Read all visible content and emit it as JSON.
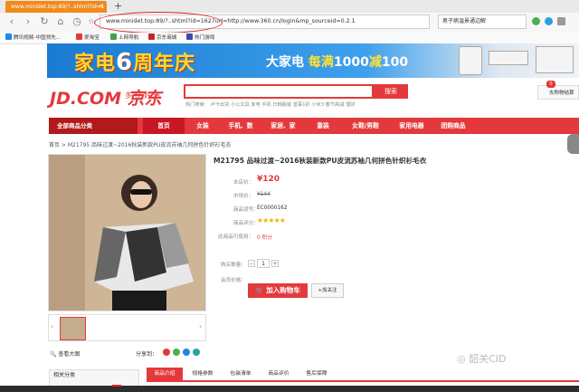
{
  "browser": {
    "tab_title": "www.minidet.top:89/?..shtml?id=1",
    "url": "www.minidet.top:89/?..shtml?id=1627url=http://www.360.cn/login&mp_sourceid=0.2.1",
    "search_text": "男子病温景通边解",
    "bookmarks": [
      "腾讯视频-中国领先...",
      "爱淘宝",
      "上网导航",
      "京东商城",
      "热门游戏"
    ]
  },
  "banner": {
    "headline_a": "家电",
    "headline_num": "6",
    "headline_b": "周年庆",
    "promo_a": "大家电",
    "promo_b": "每满",
    "promo_c": "1000",
    "promo_d": "减",
    "promo_e": "100"
  },
  "header": {
    "logo": "JD.COM 京东",
    "slogan": "多·快·好·省",
    "search_button": "搜索",
    "hot_words": "热门搜索：  卢卡出货   小公文具   家电  手机   日韩服装   雷事1折   小米3   春节高减   理财",
    "cart_label": "去购物结算",
    "cart_count": "0"
  },
  "nav": {
    "all_categories": "全部商品分类",
    "items": [
      "首页",
      "女装",
      "手机、数",
      "家居、家",
      "童装",
      "女鞋/男鞋",
      "家用电器",
      "团购商品"
    ]
  },
  "breadcrumb": "首页 > M21795 品味过渡~2016秋装新款PU皮流苏袖几何拼色针织衫毛衣",
  "product": {
    "title": "M21795 品味过渡~2016秋装新款PU皮流苏袖几何拼色针织衫毛衣",
    "price_label": "本店价：",
    "price": "¥120",
    "market_label": "市场价：",
    "market_price": "¥144",
    "sku_label": "商品货号：",
    "sku": "EC0000162",
    "rating_label": "商品评分：",
    "rating": 5,
    "points_label": "此商品可使用：",
    "points": "0 积分",
    "qty_label": "购买数量：",
    "qty": "1",
    "member_label": "会员价格：",
    "add_to_cart": "加入购物车",
    "favorite": "加关注"
  },
  "gallery": {
    "zoom": "查看大图",
    "share": "分享到："
  },
  "bottom": {
    "related": "相关分类",
    "tabs": [
      "商品介绍",
      "规格参数",
      "包装清单",
      "商品评价",
      "售后保障"
    ]
  },
  "watermark": "韶关CID",
  "colors": {
    "brand_red": "#e4393c",
    "dark_red": "#b1191a",
    "banner_blue": "#1a7ad0",
    "tab_orange": "#f08a1c"
  }
}
